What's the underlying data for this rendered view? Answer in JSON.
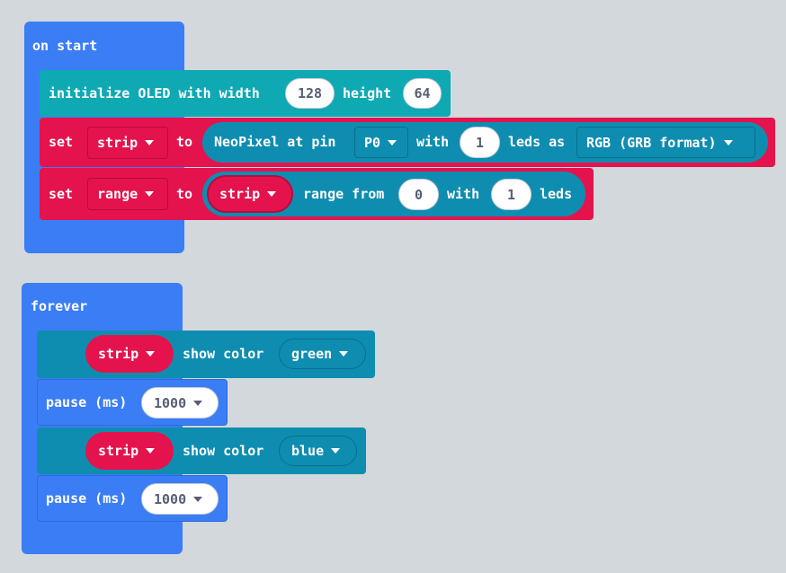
{
  "on_start": {
    "label": "on start",
    "oled": {
      "label": "initialize OLED with width",
      "width": "128",
      "height_label": "height",
      "height": "64"
    },
    "set_strip": {
      "set_label": "set",
      "var": "strip",
      "to_label": "to",
      "neopixel_label": "NeoPixel at pin",
      "pin": "P0",
      "with_label": "with",
      "leds_count": "1",
      "leds_as_label": "leds as",
      "format": "RGB (GRB format)"
    },
    "set_range": {
      "set_label": "set",
      "var": "range",
      "to_label": "to",
      "strip_var": "strip",
      "range_label": "range from",
      "from": "0",
      "with_label": "with",
      "count": "1",
      "leds_label": "leds"
    }
  },
  "forever": {
    "label": "forever",
    "blocks": [
      {
        "type": "show_color",
        "strip": "strip",
        "label": "show color",
        "color": "green"
      },
      {
        "type": "pause",
        "label": "pause (ms)",
        "value": "1000"
      },
      {
        "type": "show_color",
        "strip": "strip",
        "label": "show color",
        "color": "blue"
      },
      {
        "type": "pause",
        "label": "pause (ms)",
        "value": "1000"
      }
    ]
  },
  "colors": {
    "background": "#ecf0f1",
    "basic": "#3b7df5",
    "oled": "#0fa9b4",
    "variables": "#e4134d",
    "neopixel": "#0e8db1"
  }
}
